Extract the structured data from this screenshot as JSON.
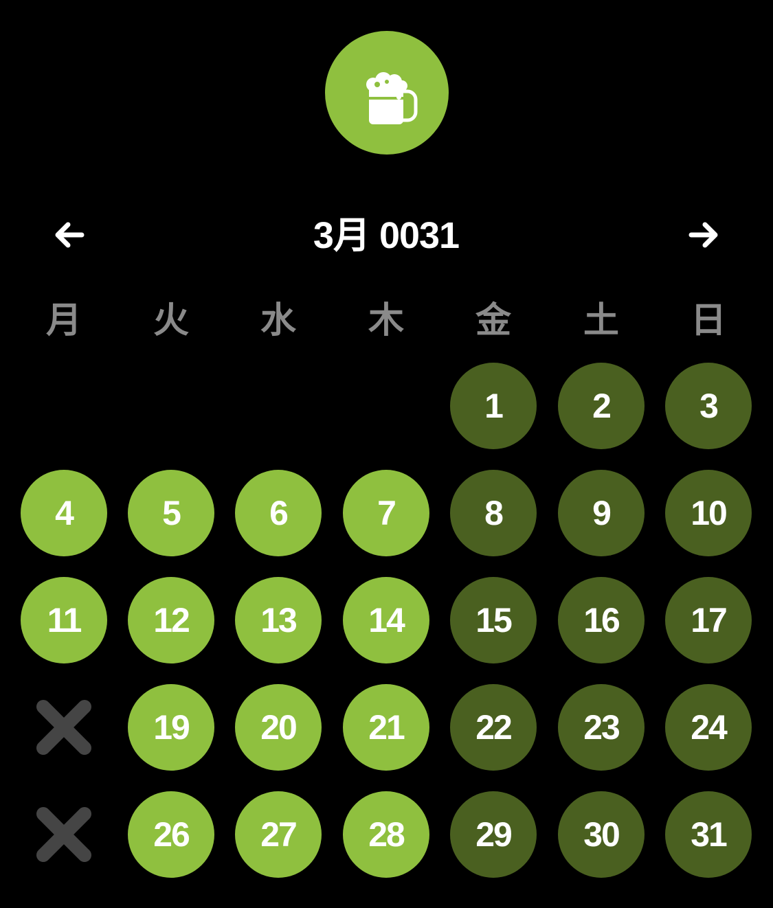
{
  "theme": {
    "accent": "#8fc03f",
    "accent_dark": "#4a6020",
    "background": "#000000",
    "weekday_color": "#8a8a8a",
    "skip_color": "#454545"
  },
  "logo": {
    "icon": "beer-mug-icon"
  },
  "header": {
    "title": "3月 0031",
    "prev_icon": "arrow-left-icon",
    "next_icon": "arrow-right-icon"
  },
  "weekdays": [
    "月",
    "火",
    "水",
    "木",
    "金",
    "土",
    "日"
  ],
  "calendar": {
    "days": [
      {
        "label": "1",
        "col": 4,
        "row": 0,
        "state": "weekend"
      },
      {
        "label": "2",
        "col": 5,
        "row": 0,
        "state": "weekend"
      },
      {
        "label": "3",
        "col": 6,
        "row": 0,
        "state": "weekend"
      },
      {
        "label": "4",
        "col": 0,
        "row": 1,
        "state": "weekday"
      },
      {
        "label": "5",
        "col": 1,
        "row": 1,
        "state": "weekday"
      },
      {
        "label": "6",
        "col": 2,
        "row": 1,
        "state": "weekday"
      },
      {
        "label": "7",
        "col": 3,
        "row": 1,
        "state": "weekday"
      },
      {
        "label": "8",
        "col": 4,
        "row": 1,
        "state": "weekend"
      },
      {
        "label": "9",
        "col": 5,
        "row": 1,
        "state": "weekend"
      },
      {
        "label": "10",
        "col": 6,
        "row": 1,
        "state": "weekend"
      },
      {
        "label": "11",
        "col": 0,
        "row": 2,
        "state": "weekday"
      },
      {
        "label": "12",
        "col": 1,
        "row": 2,
        "state": "weekday"
      },
      {
        "label": "13",
        "col": 2,
        "row": 2,
        "state": "weekday"
      },
      {
        "label": "14",
        "col": 3,
        "row": 2,
        "state": "weekday"
      },
      {
        "label": "15",
        "col": 4,
        "row": 2,
        "state": "weekend"
      },
      {
        "label": "16",
        "col": 5,
        "row": 2,
        "state": "weekend"
      },
      {
        "label": "17",
        "col": 6,
        "row": 2,
        "state": "weekend"
      },
      {
        "label": "",
        "col": 0,
        "row": 3,
        "state": "skipped",
        "icon": "x-mark-icon"
      },
      {
        "label": "19",
        "col": 1,
        "row": 3,
        "state": "weekday"
      },
      {
        "label": "20",
        "col": 2,
        "row": 3,
        "state": "weekday"
      },
      {
        "label": "21",
        "col": 3,
        "row": 3,
        "state": "weekday"
      },
      {
        "label": "22",
        "col": 4,
        "row": 3,
        "state": "weekend"
      },
      {
        "label": "23",
        "col": 5,
        "row": 3,
        "state": "weekend"
      },
      {
        "label": "24",
        "col": 6,
        "row": 3,
        "state": "weekend"
      },
      {
        "label": "",
        "col": 0,
        "row": 4,
        "state": "skipped",
        "icon": "x-mark-icon"
      },
      {
        "label": "26",
        "col": 1,
        "row": 4,
        "state": "weekday"
      },
      {
        "label": "27",
        "col": 2,
        "row": 4,
        "state": "weekday"
      },
      {
        "label": "28",
        "col": 3,
        "row": 4,
        "state": "weekday"
      },
      {
        "label": "29",
        "col": 4,
        "row": 4,
        "state": "weekend"
      },
      {
        "label": "30",
        "col": 5,
        "row": 4,
        "state": "weekend"
      },
      {
        "label": "31",
        "col": 6,
        "row": 4,
        "state": "weekend"
      }
    ]
  }
}
